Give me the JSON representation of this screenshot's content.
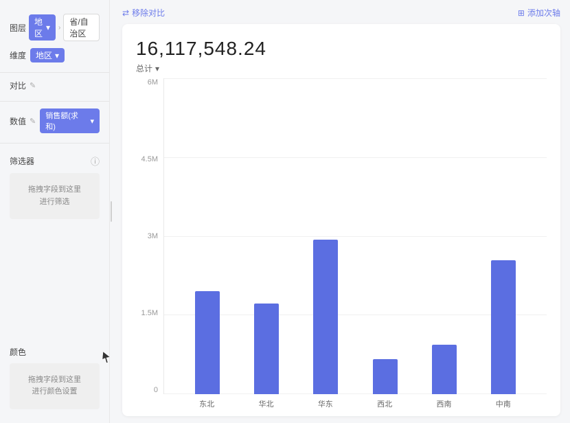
{
  "sidebar": {
    "layer_label": "图层",
    "layer_tag": "地区",
    "layer_breadcrumb_arrow": "›",
    "layer_breadcrumb": "省/自治区",
    "dimension_label": "维度",
    "dimension_tag": "地区",
    "compare_label": "对比",
    "compare_move": "移除对比",
    "value_label": "数值",
    "value_tag": "销售额(求和)",
    "add_axis": "添加次轴",
    "filter_label": "筛选器",
    "filter_info": "ℹ",
    "filter_drop_text": "拖拽字段到这里\n进行筛选",
    "color_label": "颜色",
    "color_drop_text": "拖拽字段到这里\n进行颜色设置"
  },
  "chart": {
    "big_value": "16,117,548.24",
    "subtitle": "总计",
    "y_labels": [
      "6M",
      "4.5M",
      "3M",
      "1.5M",
      "0"
    ],
    "bars": [
      {
        "label": "东北",
        "height_pct": 50
      },
      {
        "label": "华北",
        "height_pct": 44
      },
      {
        "label": "华东",
        "height_pct": 75
      },
      {
        "label": "西北",
        "height_pct": 17
      },
      {
        "label": "西南",
        "height_pct": 24
      },
      {
        "label": "中南",
        "height_pct": 65
      }
    ]
  },
  "icons": {
    "chevron_down": "▾",
    "edit": "✎",
    "move_remove": "⇄",
    "add_axis": "⊞",
    "info": "ⓘ"
  }
}
